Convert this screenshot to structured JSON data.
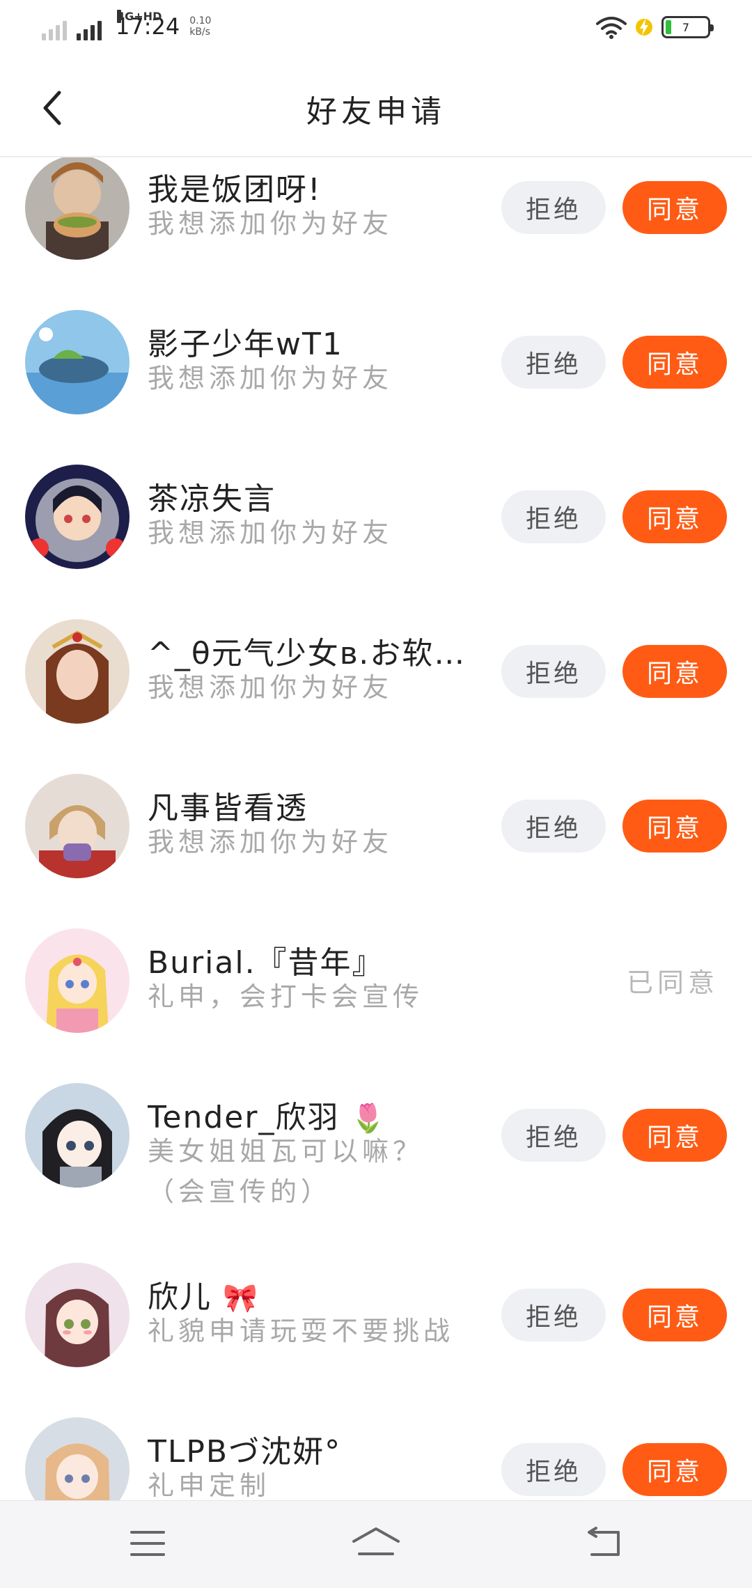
{
  "status_bar": {
    "network": "4G+HD",
    "time": "17:24",
    "speed_value": "0.10",
    "speed_unit": "kB/s",
    "battery_level": "7",
    "colors": {
      "battery_fill": "#2fbf3a",
      "charging_bolt": "#f5c400"
    }
  },
  "header": {
    "title": "好友申请",
    "back_icon": "chevron-left-icon"
  },
  "buttons": {
    "reject_label": "拒绝",
    "accept_label": "同意",
    "accepted_label": "已同意"
  },
  "requests": [
    {
      "name": "我是饭团呀!",
      "message": "我想添加你为好友",
      "status": "pending"
    },
    {
      "name": "影子少年wT1",
      "message": "我想添加你为好友",
      "status": "pending"
    },
    {
      "name": "茶凉失言",
      "message": "我想添加你为好友",
      "status": "pending"
    },
    {
      "name": "^_θ元气少女ʙ.お软 ...",
      "message": "我想添加你为好友",
      "status": "pending"
    },
    {
      "name": "凡事皆看透",
      "message": "我想添加你为好友",
      "status": "pending"
    },
    {
      "name": "Burial.『昔年』",
      "message": "礼申，会打卡会宣传",
      "status": "accepted"
    },
    {
      "name": "Tender_欣羽",
      "name_emoji": "🌷",
      "message": "美女姐姐瓦可以嘛？",
      "message_line2": "（会宣传的）",
      "status": "pending"
    },
    {
      "name": "欣儿",
      "name_emoji": "🎀",
      "message": "礼貌申请玩耍不要挑战",
      "status": "pending"
    },
    {
      "name": "TLPBづ沈妍°",
      "message": "礼申定制",
      "status": "pending"
    }
  ],
  "nav_bar": {
    "menu_icon": "menu-icon",
    "home_icon": "home-icon",
    "back_icon": "back-arrow-icon"
  },
  "colors": {
    "accent": "#ff5b14",
    "reject_bg": "#eef0f4",
    "muted_text": "#a8a8a8"
  }
}
